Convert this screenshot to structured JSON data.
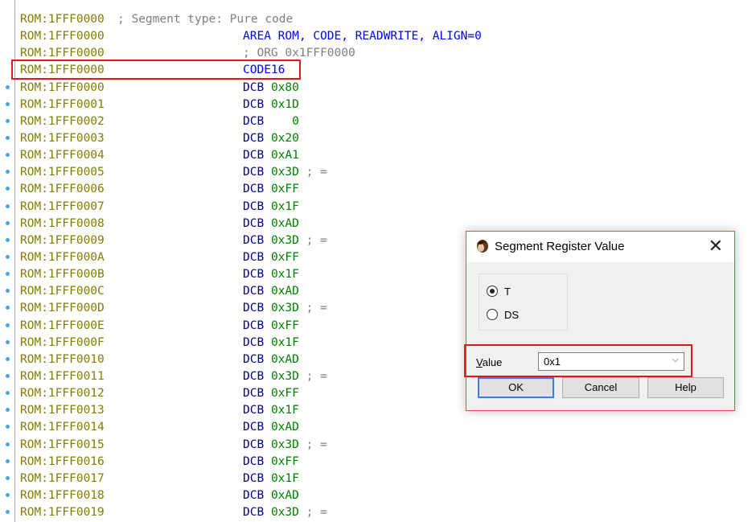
{
  "listing": {
    "rows": [
      {
        "dot": false,
        "addr": "ROM:1FFF0000",
        "instr": "; Segment type: Pure code",
        "kind": "header-comment"
      },
      {
        "dot": false,
        "addr": "ROM:1FFF0000",
        "mnem": "AREA ROM, CODE, READWRITE, ALIGN=0",
        "kind": "directive"
      },
      {
        "dot": false,
        "addr": "ROM:1FFF0000",
        "instr": "; ORG 0x1FFF0000",
        "kind": "comment"
      },
      {
        "dot": false,
        "addr": "ROM:1FFF0000",
        "mnem": "CODE16",
        "kind": "directive"
      },
      {
        "dot": true,
        "addr": "ROM:1FFF0000",
        "mnem": "DCB",
        "operand": "0x80",
        "comment": ""
      },
      {
        "dot": true,
        "addr": "ROM:1FFF0001",
        "mnem": "DCB",
        "operand": "0x1D",
        "comment": ""
      },
      {
        "dot": true,
        "addr": "ROM:1FFF0002",
        "mnem": "DCB",
        "operand": "   0",
        "comment": ""
      },
      {
        "dot": true,
        "addr": "ROM:1FFF0003",
        "mnem": "DCB",
        "operand": "0x20",
        "comment": ""
      },
      {
        "dot": true,
        "addr": "ROM:1FFF0004",
        "mnem": "DCB",
        "operand": "0xA1",
        "comment": ""
      },
      {
        "dot": true,
        "addr": "ROM:1FFF0005",
        "mnem": "DCB",
        "operand": "0x3D",
        "comment": "; ="
      },
      {
        "dot": true,
        "addr": "ROM:1FFF0006",
        "mnem": "DCB",
        "operand": "0xFF",
        "comment": ""
      },
      {
        "dot": true,
        "addr": "ROM:1FFF0007",
        "mnem": "DCB",
        "operand": "0x1F",
        "comment": ""
      },
      {
        "dot": true,
        "addr": "ROM:1FFF0008",
        "mnem": "DCB",
        "operand": "0xAD",
        "comment": ""
      },
      {
        "dot": true,
        "addr": "ROM:1FFF0009",
        "mnem": "DCB",
        "operand": "0x3D",
        "comment": "; ="
      },
      {
        "dot": true,
        "addr": "ROM:1FFF000A",
        "mnem": "DCB",
        "operand": "0xFF",
        "comment": ""
      },
      {
        "dot": true,
        "addr": "ROM:1FFF000B",
        "mnem": "DCB",
        "operand": "0x1F",
        "comment": ""
      },
      {
        "dot": true,
        "addr": "ROM:1FFF000C",
        "mnem": "DCB",
        "operand": "0xAD",
        "comment": ""
      },
      {
        "dot": true,
        "addr": "ROM:1FFF000D",
        "mnem": "DCB",
        "operand": "0x3D",
        "comment": "; ="
      },
      {
        "dot": true,
        "addr": "ROM:1FFF000E",
        "mnem": "DCB",
        "operand": "0xFF",
        "comment": ""
      },
      {
        "dot": true,
        "addr": "ROM:1FFF000F",
        "mnem": "DCB",
        "operand": "0x1F",
        "comment": ""
      },
      {
        "dot": true,
        "addr": "ROM:1FFF0010",
        "mnem": "DCB",
        "operand": "0xAD",
        "comment": ""
      },
      {
        "dot": true,
        "addr": "ROM:1FFF0011",
        "mnem": "DCB",
        "operand": "0x3D",
        "comment": "; ="
      },
      {
        "dot": true,
        "addr": "ROM:1FFF0012",
        "mnem": "DCB",
        "operand": "0xFF",
        "comment": ""
      },
      {
        "dot": true,
        "addr": "ROM:1FFF0013",
        "mnem": "DCB",
        "operand": "0x1F",
        "comment": ""
      },
      {
        "dot": true,
        "addr": "ROM:1FFF0014",
        "mnem": "DCB",
        "operand": "0xAD",
        "comment": ""
      },
      {
        "dot": true,
        "addr": "ROM:1FFF0015",
        "mnem": "DCB",
        "operand": "0x3D",
        "comment": "; ="
      },
      {
        "dot": true,
        "addr": "ROM:1FFF0016",
        "mnem": "DCB",
        "operand": "0xFF",
        "comment": ""
      },
      {
        "dot": true,
        "addr": "ROM:1FFF0017",
        "mnem": "DCB",
        "operand": "0x1F",
        "comment": ""
      },
      {
        "dot": true,
        "addr": "ROM:1FFF0018",
        "mnem": "DCB",
        "operand": "0xAD",
        "comment": ""
      },
      {
        "dot": true,
        "addr": "ROM:1FFF0019",
        "mnem": "DCB",
        "operand": "0x3D",
        "comment": "; ="
      }
    ]
  },
  "dialog": {
    "title": "Segment Register Value",
    "close_label": "✕",
    "icon": "ida-app-icon",
    "radios": [
      {
        "label": "T",
        "checked": true
      },
      {
        "label": "DS",
        "checked": false
      }
    ],
    "value_label_mnemonic": "V",
    "value_label_rest": "alue",
    "value": "0x1",
    "dropdown_arrow": "⌵",
    "buttons": {
      "ok": "OK",
      "cancel": "Cancel",
      "help": "Help"
    }
  },
  "colors": {
    "address": "#808000",
    "directive": "#0000ff",
    "mnemonic": "#000080",
    "operand": "#008000",
    "comment": "#808080",
    "highlight": "#e8141c"
  }
}
